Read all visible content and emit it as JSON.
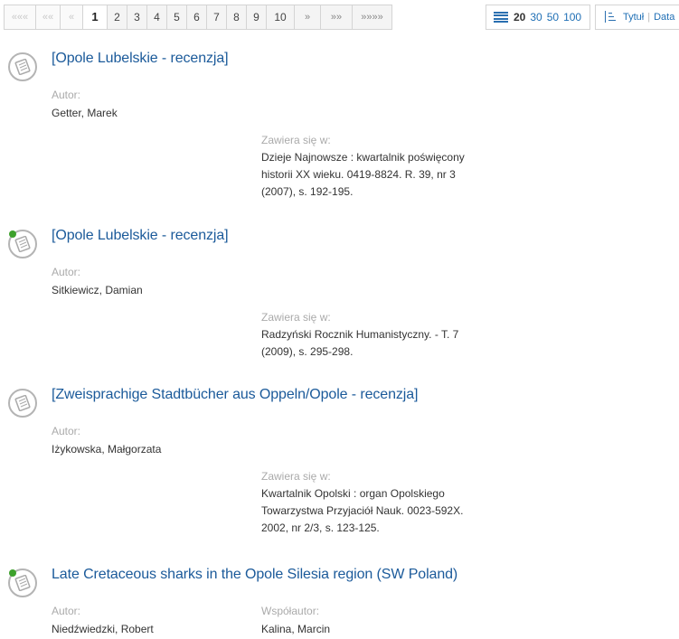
{
  "pager": {
    "first": "«««",
    "prev_many": "««",
    "prev": "«",
    "pages": [
      "1",
      "2",
      "3",
      "4",
      "5",
      "6",
      "7",
      "8",
      "9",
      "10"
    ],
    "next": "»",
    "next_many": "»»",
    "last": "»»»»"
  },
  "per_page": {
    "options": [
      "20",
      "30",
      "50",
      "100"
    ],
    "selected": "20"
  },
  "sort": {
    "title": "Tytuł",
    "date": "Data"
  },
  "labels": {
    "author": "Autor:",
    "coauthor": "Współautor:",
    "contained_in": "Zawiera się w:"
  },
  "records": [
    {
      "title": "[Opole Lubelskie - recenzja]",
      "author": "Getter, Marek",
      "source_lines": [
        "Dzieje Najnowsze : kwartalnik poświęcony",
        "historii XX wieku. 0419-8824. R. 39, nr 3",
        "(2007), s. 192-195."
      ],
      "online": false
    },
    {
      "title": "[Opole Lubelskie - recenzja]",
      "author": "Sitkiewicz, Damian",
      "source_lines": [
        "Radzyński Rocznik Humanistyczny. - T. 7",
        "(2009), s. 295-298."
      ],
      "online": true
    },
    {
      "title": "[Zweisprachige Stadtbücher aus Oppeln/Opole - recenzja]",
      "author": "Iżykowska, Małgorzata",
      "source_lines": [
        "Kwartalnik Opolski : organ Opolskiego",
        "Towarzystwa Przyjaciół Nauk. 0023-592X.",
        "2002, nr 2/3, s. 123-125."
      ],
      "online": false
    },
    {
      "title": "Late Cretaceous sharks in the Opole Silesia region (SW Poland)",
      "author": "Niedźwiedzki, Robert",
      "coauthor": "Kalina, Marcin",
      "online": true
    }
  ]
}
